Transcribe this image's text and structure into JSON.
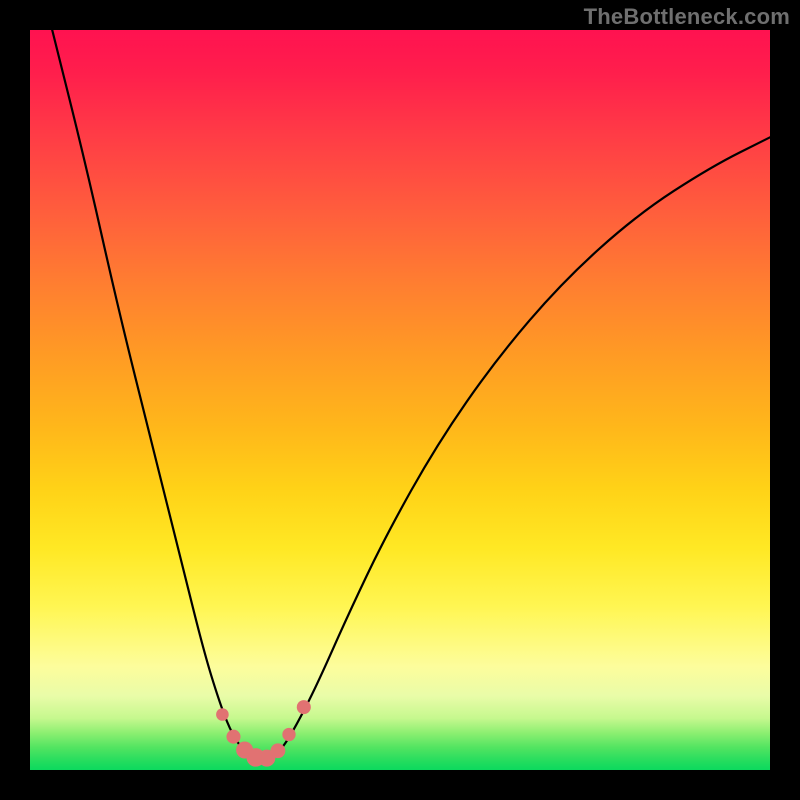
{
  "watermark": "TheBottleneck.com",
  "colors": {
    "page_bg": "#000000",
    "watermark_text": "#6f6f6f",
    "curve_stroke": "#000000",
    "bead_fill": "#e17272",
    "gradient_stops": [
      "#ff1250",
      "#ff1f4c",
      "#ff3b46",
      "#ff5c3d",
      "#ff7d31",
      "#ff9b24",
      "#ffb81a",
      "#ffd217",
      "#ffe824",
      "#fff653",
      "#fdfd9c",
      "#e9fca8",
      "#c6f88e",
      "#8cef71",
      "#51e461",
      "#1fdc5e",
      "#0cd95e"
    ]
  },
  "chart_data": {
    "type": "line",
    "title": "",
    "xlabel": "",
    "ylabel": "",
    "xlim": [
      0,
      100
    ],
    "ylim": [
      0,
      100
    ],
    "note": "x/y are percentage coordinates within the plot area. y=0 is top, y=100 is bottom; the trough at y≈100 corresponds to the minimum (green, good) region.",
    "series": [
      {
        "name": "bottleneck-curve",
        "points": [
          {
            "x": 3.0,
            "y": 0.0
          },
          {
            "x": 7.5,
            "y": 18.0
          },
          {
            "x": 12.0,
            "y": 38.0
          },
          {
            "x": 16.5,
            "y": 56.0
          },
          {
            "x": 20.5,
            "y": 72.0
          },
          {
            "x": 23.5,
            "y": 84.0
          },
          {
            "x": 25.5,
            "y": 90.5
          },
          {
            "x": 27.0,
            "y": 94.5
          },
          {
            "x": 28.5,
            "y": 97.0
          },
          {
            "x": 30.0,
            "y": 98.2
          },
          {
            "x": 31.5,
            "y": 98.6
          },
          {
            "x": 33.0,
            "y": 98.2
          },
          {
            "x": 34.5,
            "y": 96.5
          },
          {
            "x": 36.5,
            "y": 93.0
          },
          {
            "x": 39.0,
            "y": 88.0
          },
          {
            "x": 43.0,
            "y": 79.0
          },
          {
            "x": 48.0,
            "y": 68.5
          },
          {
            "x": 55.0,
            "y": 56.0
          },
          {
            "x": 63.0,
            "y": 44.5
          },
          {
            "x": 72.0,
            "y": 34.0
          },
          {
            "x": 82.0,
            "y": 25.0
          },
          {
            "x": 92.0,
            "y": 18.5
          },
          {
            "x": 100.0,
            "y": 14.5
          }
        ]
      }
    ],
    "beads": [
      {
        "x": 26.0,
        "y": 92.5,
        "r": 0.85
      },
      {
        "x": 27.5,
        "y": 95.5,
        "r": 0.95
      },
      {
        "x": 29.0,
        "y": 97.3,
        "r": 1.15
      },
      {
        "x": 30.5,
        "y": 98.3,
        "r": 1.25
      },
      {
        "x": 32.0,
        "y": 98.4,
        "r": 1.15
      },
      {
        "x": 33.5,
        "y": 97.4,
        "r": 1.0
      },
      {
        "x": 35.0,
        "y": 95.2,
        "r": 0.9
      },
      {
        "x": 37.0,
        "y": 91.5,
        "r": 0.95
      }
    ]
  }
}
